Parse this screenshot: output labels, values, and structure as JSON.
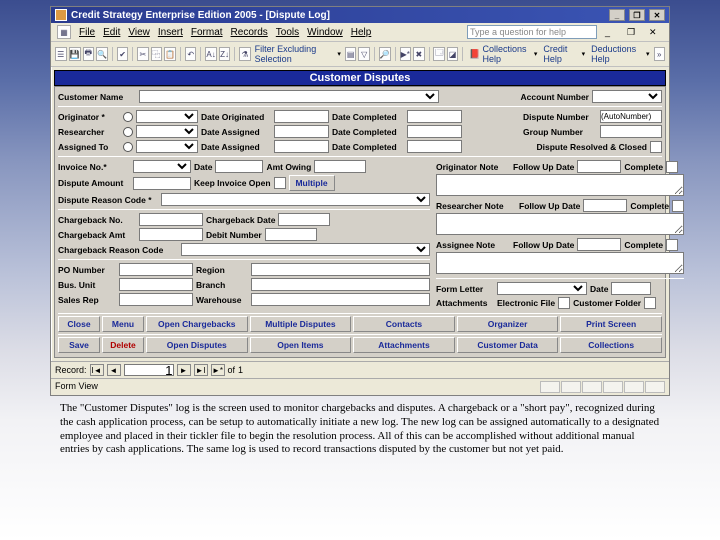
{
  "window": {
    "title": "Credit Strategy Enterprise Edition 2005 - [Dispute Log]",
    "help_placeholder": "Type a question for help"
  },
  "menus": [
    "File",
    "Edit",
    "View",
    "Insert",
    "Format",
    "Records",
    "Tools",
    "Window",
    "Help"
  ],
  "toolbar_text": {
    "filter": "Filter Excluding Selection",
    "collections": "Collections Help",
    "credit": "Credit Help",
    "deductions": "Deductions Help"
  },
  "form": {
    "title": "Customer Disputes",
    "labels": {
      "customer_name": "Customer Name",
      "account_number": "Account Number",
      "originator": "Originator *",
      "date_originated": "Date Originated",
      "date_completed": "Date Completed",
      "dispute_number": "Dispute Number",
      "dispute_number_val": "(AutoNumber)",
      "researcher": "Researcher",
      "date_assigned": "Date Assigned",
      "group_number": "Group Number",
      "assigned_to": "Assigned To",
      "dispute_resolved": "Dispute Resolved & Closed",
      "invoice_no": "Invoice No.*",
      "date": "Date",
      "amt_owing": "Amt Owing",
      "originator_note": "Originator Note",
      "follow_up": "Follow Up Date",
      "complete": "Complete",
      "dispute_amount": "Dispute Amount",
      "keep_invoice": "Keep Invoice Open",
      "multiple": "Multiple",
      "dispute_reason": "Dispute Reason Code *",
      "researcher_note": "Researcher Note",
      "chargeback_no": "Chargeback No.",
      "chargeback_date": "Chargeback Date",
      "chargeback_amt": "Chargeback Amt",
      "debit_number": "Debit Number",
      "chargeback_reason": "Chargeback Reason Code",
      "assignee_note": "Assignee Note",
      "po_number": "PO Number",
      "region": "Region",
      "bus_unit": "Bus. Unit",
      "branch": "Branch",
      "sales_rep": "Sales Rep",
      "warehouse": "Warehouse",
      "form_letter": "Form Letter",
      "attachments": "Attachments",
      "electronic_file": "Electronic File",
      "customer_folder": "Customer Folder"
    },
    "buttons_row1": [
      "Close",
      "Menu",
      "Open Chargebacks",
      "Multiple Disputes",
      "Contacts",
      "Organizer",
      "Print Screen"
    ],
    "buttons_row2": [
      "Save",
      "Delete",
      "Open Disputes",
      "Open Items",
      "Attachments",
      "Customer Data",
      "Collections"
    ]
  },
  "nav": {
    "label": "Record:",
    "pos": "1",
    "of": "of",
    "total": "1"
  },
  "status": "Form View",
  "caption": "The \"Customer Disputes\" log is the screen used to monitor chargebacks and disputes. A chargeback or a \"short pay\", recognized during the cash application process, can be setup to automatically initiate a new log. The new log can be assigned automatically to a designated employee and placed in their tickler file to begin the resolution process. All of this can be accomplished without additional manual entries by cash applications. The same log is used to record transactions disputed by the customer but not yet paid."
}
